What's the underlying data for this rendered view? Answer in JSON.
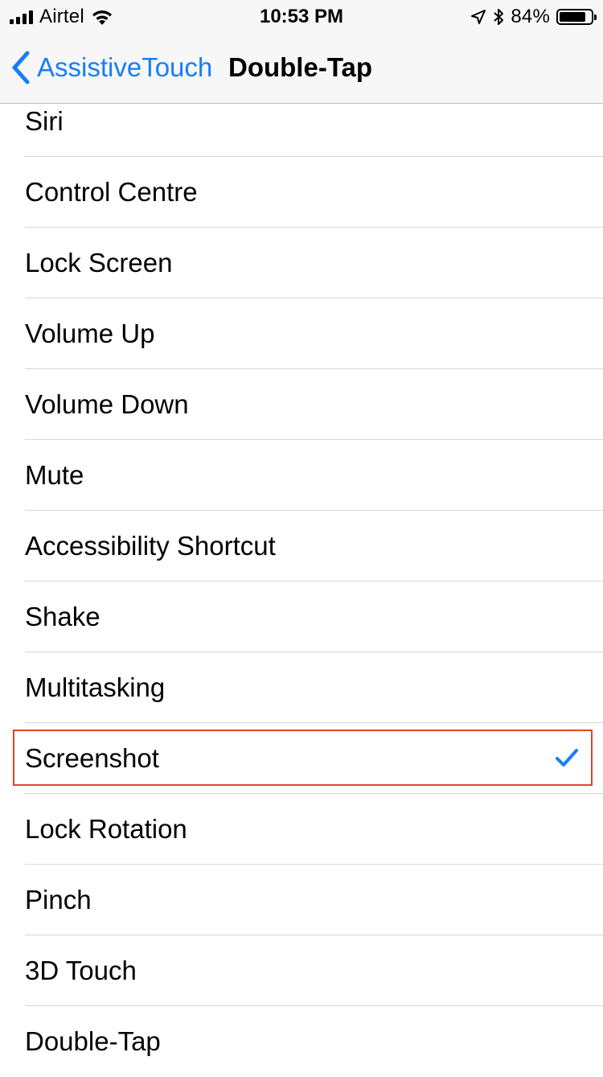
{
  "status_bar": {
    "carrier": "Airtel",
    "time": "10:53 PM",
    "battery": "84%",
    "battery_level": 0.84,
    "icons": [
      "signal-bars-icon",
      "wifi-icon",
      "location-arrow-icon",
      "bluetooth-icon",
      "battery-icon"
    ]
  },
  "nav": {
    "back_label": "AssistiveTouch",
    "title": "Double-Tap"
  },
  "options": [
    {
      "label": "Siri",
      "selected": false
    },
    {
      "label": "Control Centre",
      "selected": false
    },
    {
      "label": "Lock Screen",
      "selected": false
    },
    {
      "label": "Volume Up",
      "selected": false
    },
    {
      "label": "Volume Down",
      "selected": false
    },
    {
      "label": "Mute",
      "selected": false
    },
    {
      "label": "Accessibility Shortcut",
      "selected": false
    },
    {
      "label": "Shake",
      "selected": false
    },
    {
      "label": "Multitasking",
      "selected": false
    },
    {
      "label": "Screenshot",
      "selected": true
    },
    {
      "label": "Lock Rotation",
      "selected": false
    },
    {
      "label": "Pinch",
      "selected": false
    },
    {
      "label": "3D Touch",
      "selected": false
    },
    {
      "label": "Double-Tap",
      "selected": false
    }
  ],
  "colors": {
    "accent": "#157efb",
    "highlight_border": "#e0452e"
  }
}
